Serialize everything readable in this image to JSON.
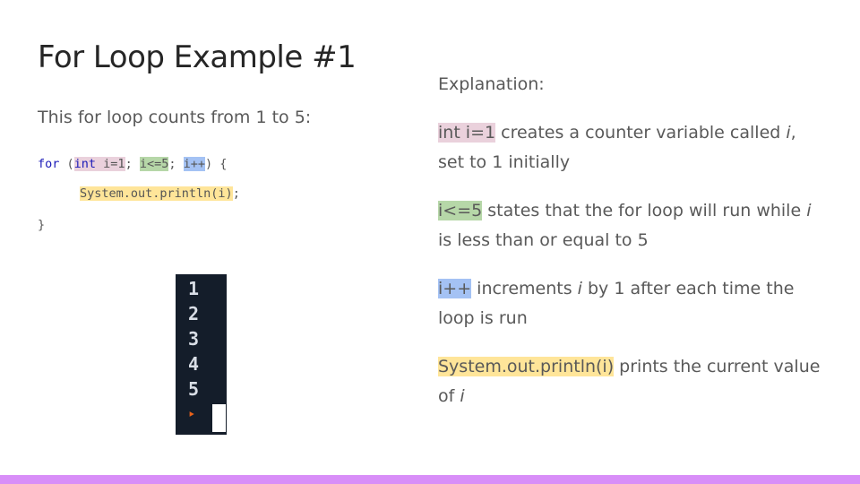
{
  "slide": {
    "title": "For Loop Example #1",
    "subtitle": "This for loop counts from 1 to 5:"
  },
  "code": {
    "line1": {
      "kw_for": "for",
      "open_paren": " (",
      "init_type": "int",
      "init_rest": " i=1",
      "sep1": "; ",
      "condition": "i<=5",
      "sep2": "; ",
      "increment": "i++",
      "close": ") {"
    },
    "line2": {
      "statement": "System.out.println(i)",
      "semicolon": ";"
    },
    "line3": "}"
  },
  "terminal": {
    "lines": [
      "1",
      "2",
      "3",
      "4",
      "5"
    ],
    "prompt": "‣"
  },
  "explanation": {
    "heading": "Explanation:",
    "items": [
      {
        "highlight": "int i=1",
        "text_a": " creates a counter variable called ",
        "italic": "i",
        "text_b": ", set to 1 initially"
      },
      {
        "highlight": "i<=5",
        "text_a": " states that the for loop will run while ",
        "italic": "i",
        "text_b": " is less than or equal to 5"
      },
      {
        "highlight": "i++",
        "text_a": " increments ",
        "italic": "i",
        "text_b": " by 1 after each time the loop is run"
      },
      {
        "highlight": "System.out.println(i)",
        "text_a": " prints the current value of ",
        "italic": "i",
        "text_b": ""
      }
    ]
  },
  "colors": {
    "highlight_pink": "#ead1dc",
    "highlight_green": "#b6d7a8",
    "highlight_blue": "#a4c2f4",
    "highlight_yellow": "#ffe599",
    "bottom_bar": "#d88ef8",
    "terminal_bg": "#141d2a"
  }
}
